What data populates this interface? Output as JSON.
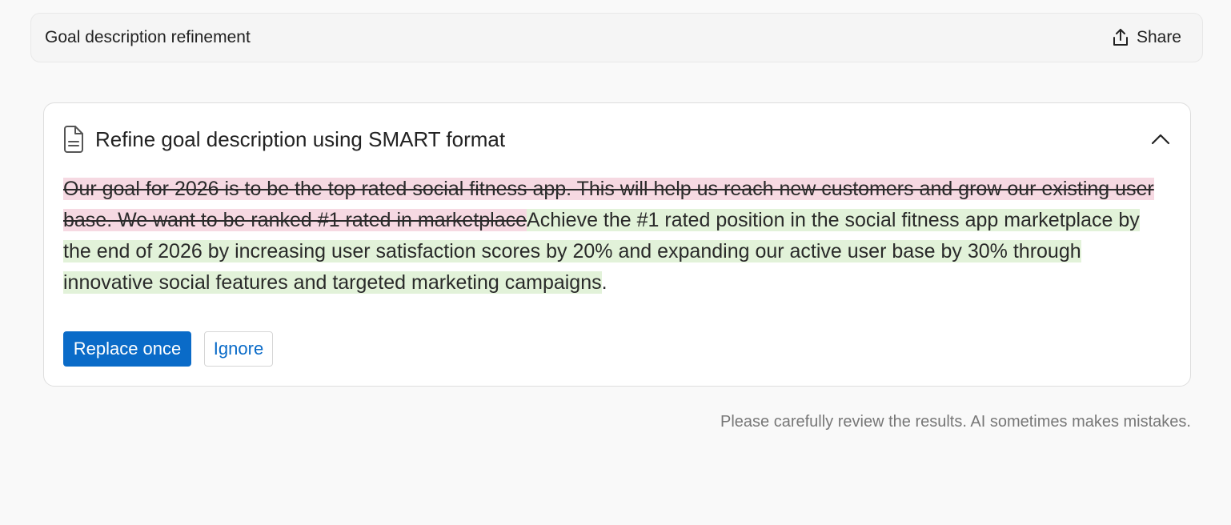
{
  "header": {
    "title": "Goal description refinement",
    "share_label": "Share",
    "share_icon": "share-upload-icon"
  },
  "card": {
    "title": "Refine goal description using SMART format",
    "title_icon": "document-icon",
    "toggle_icon": "chevron-up-icon",
    "diff": {
      "removed_text": "Our goal for 2026 is to be the top rated social fitness app. This will help us reach new customers and grow our existing user base. We want to be ranked #1 rated in marketplace",
      "added_text": "Achieve the #1 rated position in the social fitness app marketplace by the end of 2026 by increasing user satisfaction scores by 20% and expanding our active user base by 30% through innovative social features and targeted marketing campaigns",
      "trailing_text": "."
    },
    "actions": {
      "replace_label": "Replace once",
      "ignore_label": "Ignore"
    }
  },
  "footer": {
    "disclaimer": "Please carefully review the results. AI sometimes makes mistakes."
  },
  "colors": {
    "primary": "#0a6bc8",
    "removed_highlight": "#f6d9e2",
    "added_highlight": "#e2f2d9",
    "background": "#f9f9f9"
  }
}
